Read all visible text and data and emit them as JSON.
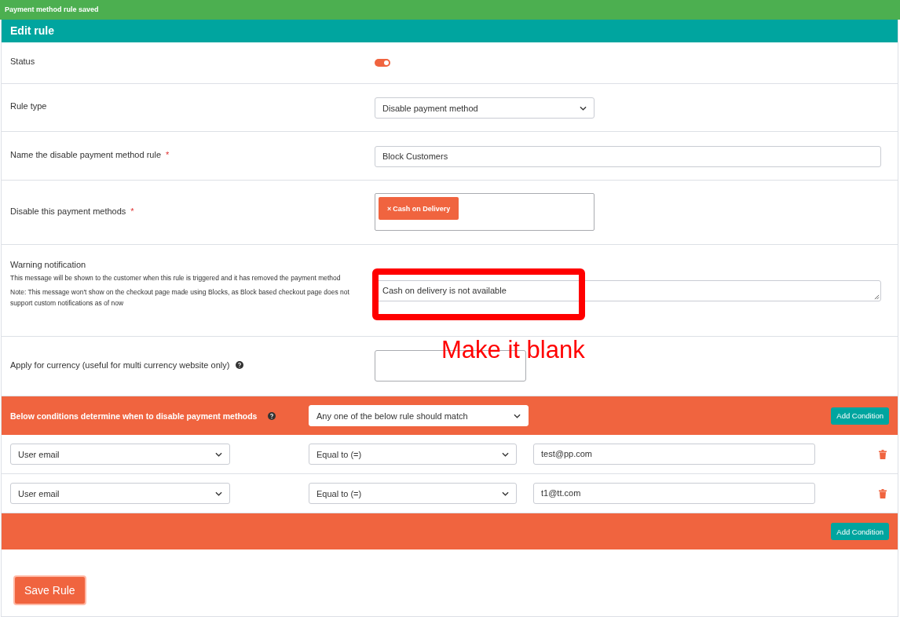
{
  "notice": "Payment method rule saved",
  "panel": {
    "title": "Edit rule"
  },
  "fields": [
    {
      "kind": "toggle",
      "label": "Status",
      "on": true
    },
    {
      "kind": "select",
      "label": "Rule type",
      "value": "Disable payment method"
    },
    {
      "kind": "text",
      "label": "Name the disable payment method rule",
      "required_mark": "*",
      "value": "Block Customers"
    },
    {
      "kind": "tags",
      "label": "Disable this payment methods",
      "required_mark": "*",
      "tags": [
        {
          "remove": "×",
          "label": "Cash on Delivery"
        }
      ]
    },
    {
      "kind": "textarea",
      "label": "Warning notification",
      "notes": [
        "This message will be shown to the customer when this rule is triggered and it has removed the payment method",
        "Note: This message won't show on the checkout page made using Blocks, as Block based checkout page does not support custom notifications as of now"
      ],
      "value": "Cash on delivery is not available"
    },
    {
      "kind": "small_text",
      "label": "Apply for currency (useful for multi currency website only)",
      "help": true
    }
  ],
  "conditions": {
    "title": "Below conditions determine when to disable payment methods",
    "help": true,
    "match": "Any one of the below rule should match",
    "add_button": "Add Condition",
    "rows": [
      {
        "field": "User email",
        "operator": "Equal to (=)",
        "value": "test@pp.com"
      },
      {
        "field": "User email",
        "operator": "Equal to (=)",
        "value": "t1@tt.com"
      }
    ],
    "footer_button": "Add Condition"
  },
  "save_button": "Save Rule",
  "annotation": {
    "text": "Make it blank"
  }
}
